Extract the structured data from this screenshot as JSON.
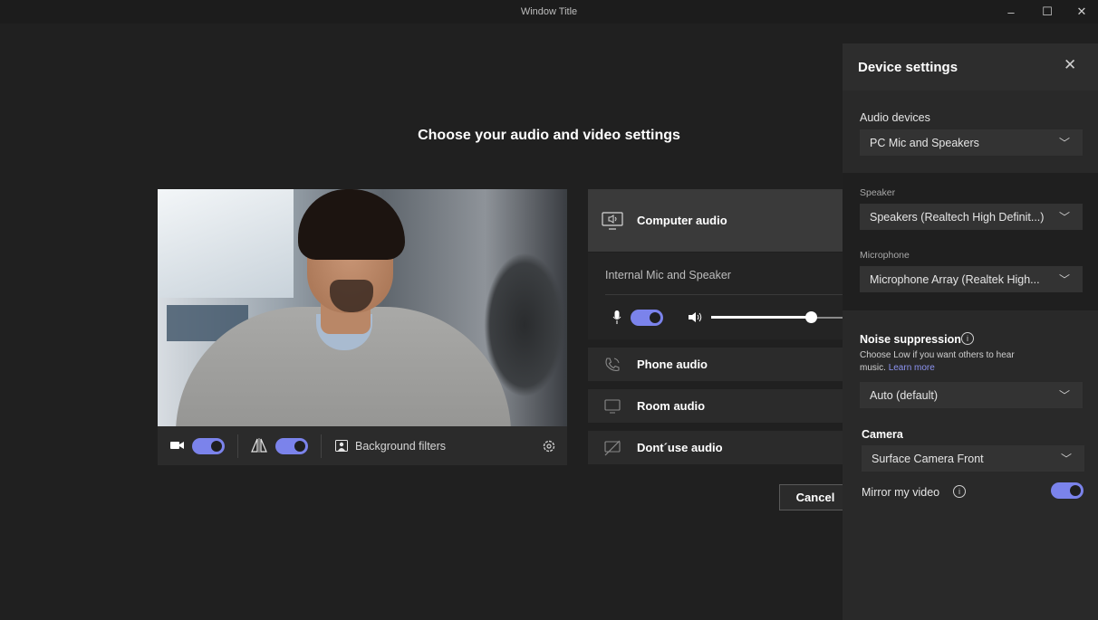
{
  "window": {
    "title": "Window Title",
    "min_icon": "–",
    "max_icon": "☐",
    "close_icon": "✕"
  },
  "main": {
    "heading": "Choose your audio and video settings",
    "video_controls": {
      "background_filters_label": "Background filters"
    },
    "audio": {
      "computer_audio_label": "Computer audio",
      "device_name": "Internal Mic and Speaker",
      "phone_audio_label": "Phone audio",
      "room_audio_label": "Room audio",
      "dont_use_audio_label": "Dont´use audio",
      "volume_level": 0.75
    },
    "cancel_label": "Cancel"
  },
  "panel": {
    "title": "Device settings",
    "audio_devices_label": "Audio devices",
    "audio_devices_value": "PC Mic and Speakers",
    "speaker_label": "Speaker",
    "speaker_value": "Speakers (Realtech High Definit...)",
    "microphone_label": "Microphone",
    "microphone_value": "Microphone Array (Realtek High...",
    "noise_label": "Noise suppression",
    "noise_hint": "Choose Low if you want others to hear music.",
    "noise_link": "Learn more",
    "noise_value": "Auto (default)",
    "camera_label": "Camera",
    "camera_value": "Surface Camera Front",
    "mirror_label": "Mirror my video",
    "mirror_on": true
  },
  "colors": {
    "accent": "#7b83eb",
    "background": "#202020",
    "panel": "#292929"
  }
}
